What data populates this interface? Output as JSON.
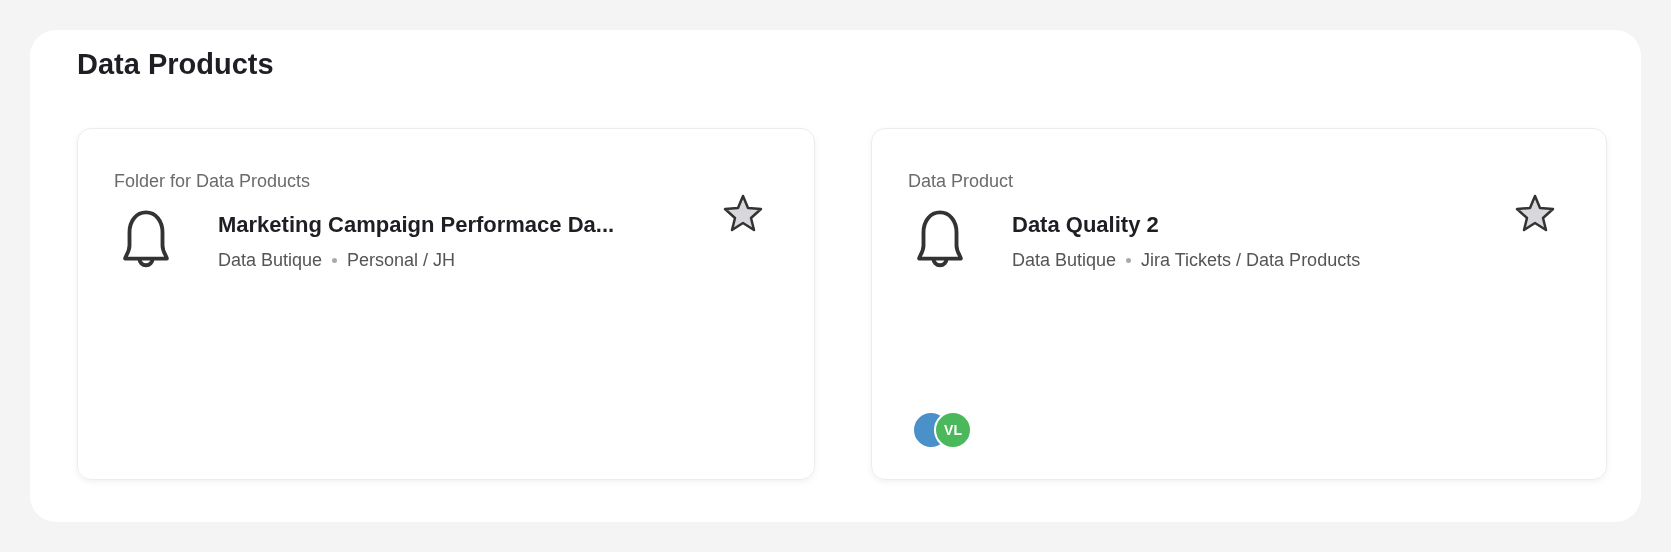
{
  "section": {
    "title": "Data Products"
  },
  "cards": [
    {
      "type_label": "Folder for Data Products",
      "title": "Marketing Campaign Performace Da...",
      "source": "Data Butique",
      "path": "Personal / JH"
    },
    {
      "type_label": "Data Product",
      "title": "Data Quality 2",
      "source": "Data Butique",
      "path": "Jira Tickets / Data Products",
      "avatars": [
        {
          "color": "#4a90c9"
        },
        {
          "initials": "VL",
          "color": "#4cb85c"
        }
      ]
    }
  ]
}
